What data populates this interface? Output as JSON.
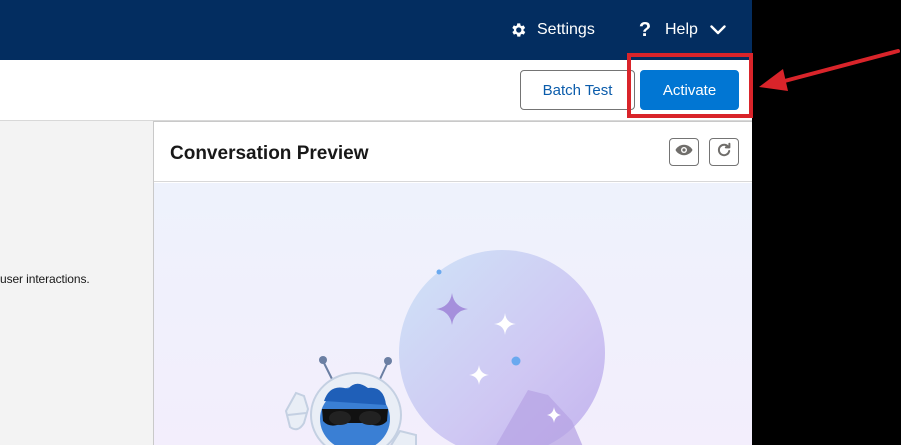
{
  "header": {
    "settings_label": "Settings",
    "settings_icon": "gear-icon",
    "help_label": "Help",
    "help_icon": "question-icon",
    "help_chevron_icon": "chevron-down-icon"
  },
  "toolbar": {
    "batch_test_label": "Batch Test",
    "activate_label": "Activate"
  },
  "left_panel": {
    "description_fragment": "user interactions."
  },
  "preview": {
    "title": "Conversation Preview",
    "view_icon": "eye-icon",
    "refresh_icon": "refresh-icon"
  },
  "annotation": {
    "highlight_color": "#d9242a",
    "arrow_color": "#d9242a"
  },
  "colors": {
    "header_bg": "#032d60",
    "brand": "#0176d3",
    "neutral_text": "#0b5cab"
  }
}
